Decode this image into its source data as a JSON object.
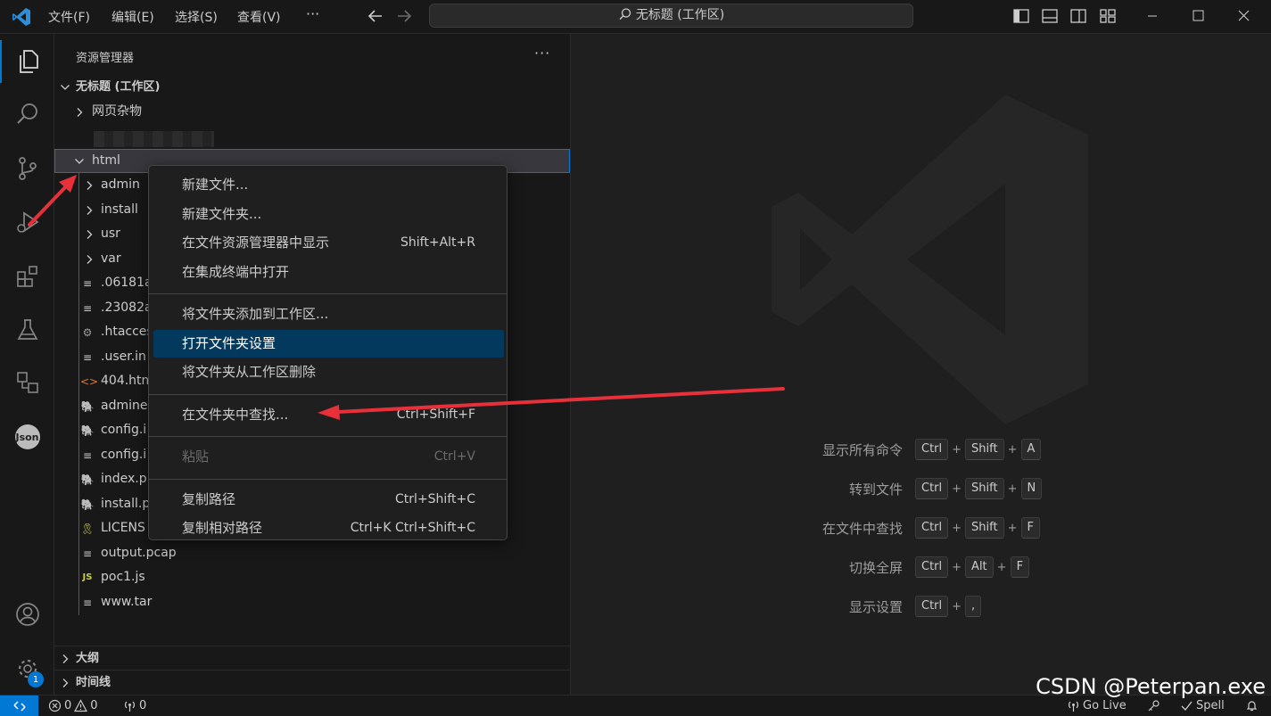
{
  "titlebar": {
    "menus": [
      "文件(F)",
      "编辑(E)",
      "选择(S)",
      "查看(V)"
    ],
    "more": "···",
    "search_text": "无标题 (工作区)"
  },
  "activity_icons": [
    "files-icon",
    "search-icon",
    "source-control-icon",
    "run-debug-icon",
    "extensions-icon",
    "testing-icon",
    "remote-explorer-icon",
    "json-icon"
  ],
  "activity_json_label": "Json",
  "settings_badge": "1",
  "sidebar": {
    "title": "资源管理器",
    "more": "···",
    "workspace": "无标题 (工作区)",
    "folder_web": "网页杂物",
    "selected_folder": "html",
    "tree": [
      {
        "label": "admin",
        "icon": "chevron-right-icon",
        "type": "folder"
      },
      {
        "label": "install",
        "icon": "chevron-right-icon",
        "type": "folder"
      },
      {
        "label": "usr",
        "icon": "chevron-right-icon",
        "type": "folder"
      },
      {
        "label": "var",
        "icon": "chevron-right-icon",
        "type": "folder"
      },
      {
        "label": ".06181a",
        "icon": "text-file-icon",
        "type": "file"
      },
      {
        "label": ".23082a",
        "icon": "text-file-icon",
        "type": "file"
      },
      {
        "label": ".htacces",
        "icon": "settings-file-icon",
        "type": "file"
      },
      {
        "label": ".user.in",
        "icon": "text-file-icon",
        "type": "file"
      },
      {
        "label": "404.htm",
        "icon": "html-file-icon",
        "type": "file"
      },
      {
        "label": "admine",
        "icon": "php-file-icon",
        "type": "file"
      },
      {
        "label": "config.i",
        "icon": "php-file-icon",
        "type": "file"
      },
      {
        "label": "config.i",
        "icon": "text-file-icon",
        "type": "file"
      },
      {
        "label": "index.p",
        "icon": "php-file-icon",
        "type": "file"
      },
      {
        "label": "install.p",
        "icon": "php-file-icon",
        "type": "file"
      },
      {
        "label": "LICENS",
        "icon": "license-file-icon",
        "type": "file"
      },
      {
        "label": "output.pcap",
        "icon": "text-file-icon",
        "type": "file"
      },
      {
        "label": "poc1.js",
        "icon": "js-file-icon",
        "type": "file"
      },
      {
        "label": "www.tar",
        "icon": "text-file-icon",
        "type": "file"
      }
    ],
    "outline": "大纲",
    "timeline": "时间线"
  },
  "context_menu": {
    "groups": [
      [
        {
          "label": "新建文件...",
          "key": ""
        },
        {
          "label": "新建文件夹...",
          "key": ""
        },
        {
          "label": "在文件资源管理器中显示",
          "key": "Shift+Alt+R"
        },
        {
          "label": "在集成终端中打开",
          "key": ""
        }
      ],
      [
        {
          "label": "将文件夹添加到工作区...",
          "key": ""
        },
        {
          "label": "打开文件夹设置",
          "key": "",
          "highlighted": true
        },
        {
          "label": "将文件夹从工作区删除",
          "key": ""
        }
      ],
      [
        {
          "label": "在文件夹中查找...",
          "key": "Ctrl+Shift+F"
        }
      ],
      [
        {
          "label": "粘贴",
          "key": "Ctrl+V",
          "disabled": true
        }
      ],
      [
        {
          "label": "复制路径",
          "key": "Ctrl+Shift+C"
        },
        {
          "label": "复制相对路径",
          "key": "Ctrl+K Ctrl+Shift+C"
        }
      ]
    ]
  },
  "shortcuts": [
    {
      "label": "显示所有命令",
      "keys": [
        "Ctrl",
        "Shift",
        "A"
      ]
    },
    {
      "label": "转到文件",
      "keys": [
        "Ctrl",
        "Shift",
        "N"
      ]
    },
    {
      "label": "在文件中查找",
      "keys": [
        "Ctrl",
        "Shift",
        "F"
      ]
    },
    {
      "label": "切换全屏",
      "keys": [
        "Ctrl",
        "Alt",
        "F"
      ]
    },
    {
      "label": "显示设置",
      "keys": [
        "Ctrl",
        ","
      ]
    }
  ],
  "statusbar": {
    "errors": "0",
    "warnings": "0",
    "ports": "0",
    "go_live": "Go Live",
    "spell": "Spell"
  },
  "watermark_text": "CSDN @Peterpan.exe",
  "colors": {
    "accent": "#0078d4",
    "highlight": "#04395e",
    "annotation_arrow": "#e8303a"
  }
}
